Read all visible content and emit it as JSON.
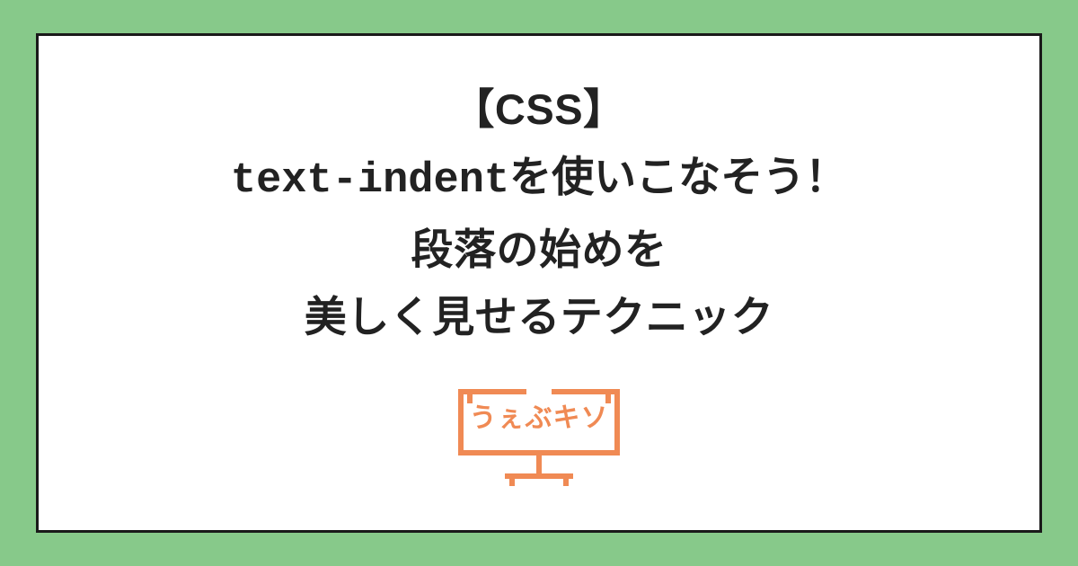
{
  "title": {
    "line1": "【CSS】",
    "line2": "text-indentを使いこなそう！",
    "line3": "段落の始めを",
    "line4": "美しく見せるテクニック"
  },
  "logo": {
    "text": "うぇぶキソ",
    "icon_name": "monitor-icon"
  },
  "colors": {
    "bg": "#87c98a",
    "card_bg": "#ffffff",
    "border": "#1a1a1a",
    "text": "#222222",
    "accent": "#f08a54"
  }
}
